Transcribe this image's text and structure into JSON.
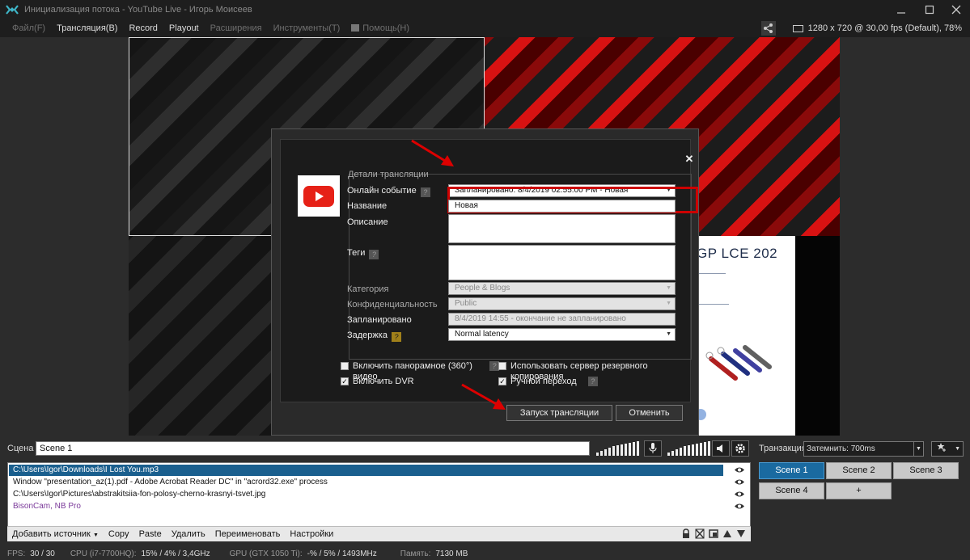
{
  "window": {
    "title": "Инициализация потока - YouTube Live - Игорь Моисеев"
  },
  "menu": {
    "file": "Файл(F)",
    "broadcast": "Трансляция(B)",
    "record": "Record",
    "playout": "Playout",
    "extensions": "Расширения",
    "tools": "Инструменты(T)",
    "help": "Помощь(H)",
    "resolution": "1280 x 720 @ 30,00 fps (Default), 78%"
  },
  "preview": {
    "pdf_title": "GP LCE 202"
  },
  "dialog": {
    "group_title": "Детали трансляции",
    "fields": {
      "event": {
        "label": "Онлайн событие",
        "value": "Запланировано: 8/4/2019 02:55:00 PM - Новая"
      },
      "name": {
        "label": "Название",
        "value": "Новая"
      },
      "description": {
        "label": "Описание"
      },
      "tags": {
        "label": "Теги"
      },
      "category": {
        "label": "Категория",
        "value": "People & Blogs"
      },
      "privacy": {
        "label": "Конфиденциальность",
        "value": "Public"
      },
      "scheduled": {
        "label": "Запланировано",
        "value": "8/4/2019 14:55 - окончание не запланировано"
      },
      "latency": {
        "label": "Задержка",
        "value": "Normal latency"
      }
    },
    "checkboxes": {
      "panoramic": {
        "label": "Включить панорамное (360°) видео",
        "checked": false
      },
      "backup": {
        "label": "Использовать сервер резервного копирования",
        "checked": false
      },
      "dvr": {
        "label": "Включить DVR",
        "checked": true
      },
      "manual": {
        "label": "Ручной переход",
        "checked": true
      }
    },
    "start_button": "Запуск трансляции",
    "cancel_button": "Отменить",
    "help_mark": "?"
  },
  "scene": {
    "label": "Сцена",
    "value": "Scene 1"
  },
  "sources": [
    {
      "text": "C:\\Users\\Igor\\Downloads\\I Lost You.mp3",
      "selected": true
    },
    {
      "text": "Window \"presentation_az(1).pdf - Adobe Acrobat Reader DC\" in \"acrord32.exe\" process"
    },
    {
      "text": "C:\\Users\\Igor\\Pictures\\abstrakitsiia-fon-polosy-cherno-krasnyi-tsvet.jpg"
    },
    {
      "text": "BisonCam, NB Pro"
    }
  ],
  "toolbar": {
    "add": "Добавить источник",
    "copy": "Copy",
    "paste": "Paste",
    "delete": "Удалить",
    "rename": "Переименовать",
    "settings": "Настройки"
  },
  "transition": {
    "label": "Транзакция",
    "value": "Затемнить: 700ms"
  },
  "scenes": [
    "Scene 1",
    "Scene 2",
    "Scene 3",
    "Scene 4",
    "+"
  ],
  "status": {
    "fps_label": "FPS:",
    "fps": "30 / 30",
    "cpu_label": "CPU (i7-7700HQ):",
    "cpu": "15% / 4% / 3,4GHz",
    "gpu_label": "GPU (GTX 1050 Ti):",
    "gpu": "-% / 5% / 1493MHz",
    "mem_label": "Память:",
    "mem": "7130 MB"
  },
  "colors": {
    "accent": "#1a6aa0",
    "highlight": "#cc0000",
    "youtube": "#e62117"
  }
}
